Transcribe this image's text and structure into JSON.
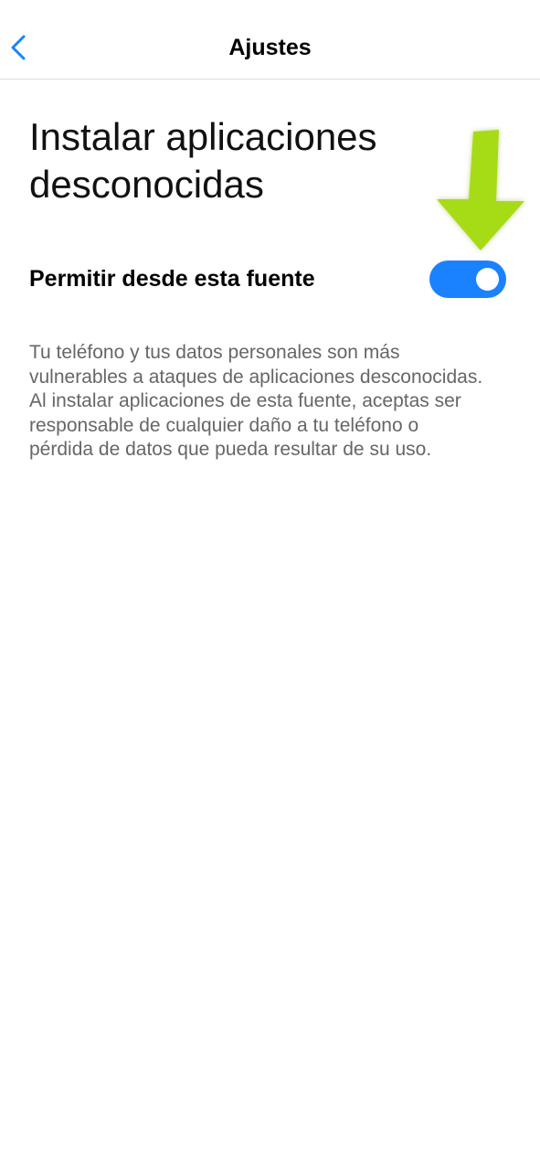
{
  "header": {
    "title": "Ajustes",
    "back_icon": "chevron-left-icon"
  },
  "page": {
    "title": "Instalar aplicaciones desconocidas"
  },
  "setting": {
    "label": "Permitir desde esta fuente",
    "enabled": true
  },
  "description": "Tu teléfono y tus datos personales son más vulnerables a ataques de aplicaciones desconocidas. Al instalar aplicaciones de esta fuente, aceptas ser responsable de cualquier daño a tu teléfono o pérdida de datos que pueda resultar de su uso.",
  "annotation": {
    "icon": "arrow-down-icon",
    "color": "#a6dc16"
  },
  "colors": {
    "accent": "#1a82ff",
    "description_text": "#666666"
  }
}
